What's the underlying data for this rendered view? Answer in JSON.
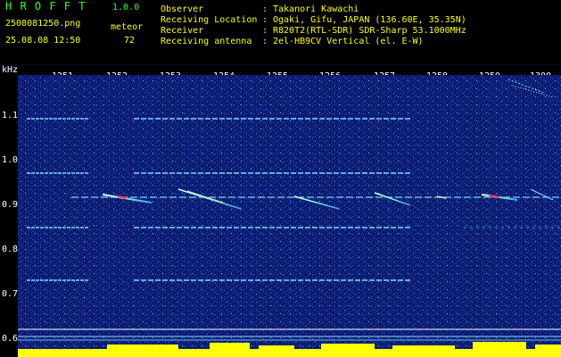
{
  "header": {
    "logo": "H R O F F T",
    "version": "1.0.0",
    "filename": "250808125‌0.png",
    "datetime": "25.08.08 12:50",
    "count_label": "meteor",
    "count_value": "72",
    "info": [
      {
        "label": "Observer",
        "sep": ":",
        "value": "Takanori Kawachi"
      },
      {
        "label": "Receiving Location",
        "sep": ":",
        "value": "Ogaki, Gifu, JAPAN (136.60E, 35.35N)"
      },
      {
        "label": "Receiver",
        "sep": ":",
        "value": "R820T2(RTL-SDR) SDR-Sharp 53.1000MHz"
      },
      {
        "label": "Receiving antenna",
        "sep": ":",
        "value": "2el-HB9CV Vertical (el. E-W)"
      }
    ]
  },
  "spectrogram": {
    "y_unit": "kHz",
    "y_ticks": [
      "1.1",
      "1.0",
      "0.9",
      "0.8",
      "0.7",
      "0.6"
    ],
    "x_ticks": [
      "1251",
      "1252",
      "1253",
      "1254",
      "1255",
      "1256",
      "1257",
      "1258",
      "1259",
      "1300"
    ],
    "colors": {
      "background": "#0a1a6e",
      "carrier": "#7fd8ff",
      "meteor": "#e0ffff",
      "hot": "#ff3a5a",
      "yellow_bars": "#ffff00",
      "scale_white": "#ffffff"
    }
  }
}
